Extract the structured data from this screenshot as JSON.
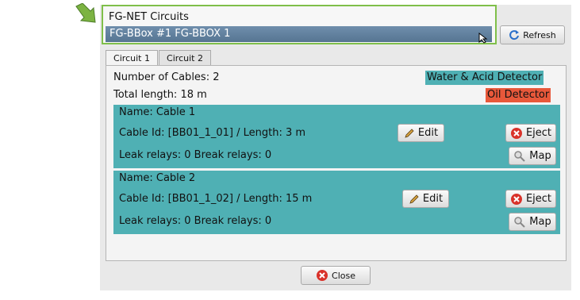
{
  "dropdown": {
    "title": "FG-NET Circuits",
    "selected": "FG-BBox #1 FG-BBOX 1"
  },
  "refresh_label": "Refresh",
  "tabs": [
    {
      "label": "Circuit 1",
      "active": true
    },
    {
      "label": "Circuit 2",
      "active": false
    }
  ],
  "summary": {
    "cables": "Number of Cables: 2",
    "length": "Total length: 18 m"
  },
  "detectors": [
    {
      "label": "Water & Acid Detector",
      "color": "#4fb0b4"
    },
    {
      "label": "Oil Detector",
      "color": "#e8583a"
    }
  ],
  "cables": [
    {
      "name": "Name: Cable 1",
      "id_length": "Cable Id: [BB01_1_01] / Length: 3 m",
      "relays": "Leak relays: 0  Break relays: 0"
    },
    {
      "name": "Name: Cable 2",
      "id_length": "Cable Id: [BB01_1_02] / Length: 15 m",
      "relays": "Leak relays: 0  Break relays: 0"
    }
  ],
  "buttons": {
    "edit": "Edit",
    "eject": "Eject",
    "map": "Map",
    "close": "Close"
  },
  "colors": {
    "highlight": "#7fbf4a",
    "cable_bg": "#4fb0b4",
    "oil": "#e8583a",
    "selected_bg": "#5f7f9e"
  }
}
